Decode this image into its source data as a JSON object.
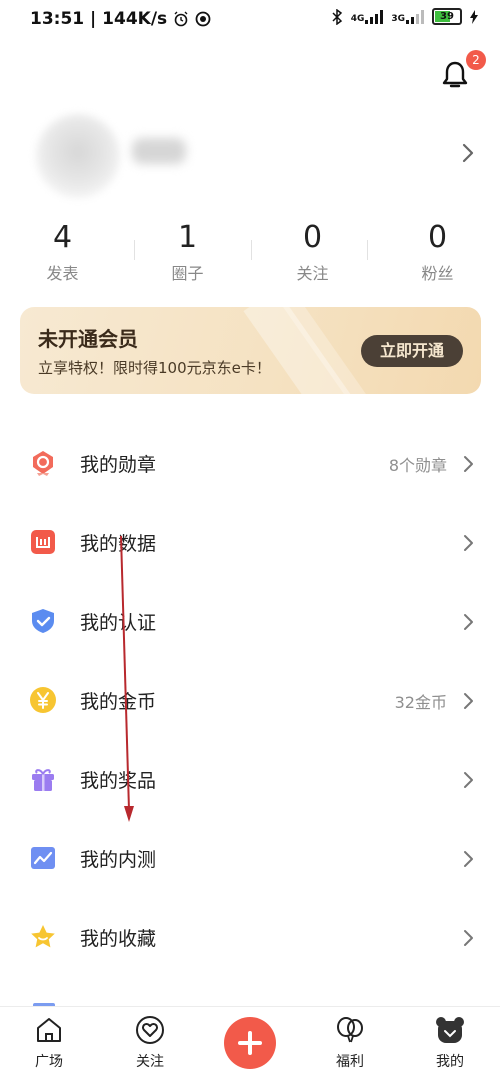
{
  "status_bar": {
    "time_speed": "13:51 | 144K/s",
    "net1": "4G",
    "net2": "3G",
    "battery": "39"
  },
  "notifications": {
    "badge_count": "2"
  },
  "stats": [
    {
      "value": "4",
      "label": "发表"
    },
    {
      "value": "1",
      "label": "圈子"
    },
    {
      "value": "0",
      "label": "关注"
    },
    {
      "value": "0",
      "label": "粉丝"
    }
  ],
  "vip_card": {
    "title": "未开通会员",
    "subtitle": "立享特权！限时得100元京东e卡！",
    "button": "立即开通"
  },
  "menu": [
    {
      "label": "我的勋章",
      "value": "8个勋章",
      "icon": "medal-icon",
      "color": "#f26b5b"
    },
    {
      "label": "我的数据",
      "value": "",
      "icon": "data-icon",
      "color": "#f25a4a"
    },
    {
      "label": "我的认证",
      "value": "",
      "icon": "shield-icon",
      "color": "#5b8cf0"
    },
    {
      "label": "我的金币",
      "value": "32金币",
      "icon": "coin-icon",
      "color": "#f7c531"
    },
    {
      "label": "我的奖品",
      "value": "",
      "icon": "gift-icon",
      "color": "#9b7cf0"
    },
    {
      "label": "我的内测",
      "value": "",
      "icon": "beta-chart-icon",
      "color": "#6f8ff2"
    },
    {
      "label": "我的收藏",
      "value": "",
      "icon": "star-icon",
      "color": "#f7c531"
    }
  ],
  "tabbar": {
    "home": "广场",
    "follow": "关注",
    "welfare": "福利",
    "mine": "我的"
  }
}
